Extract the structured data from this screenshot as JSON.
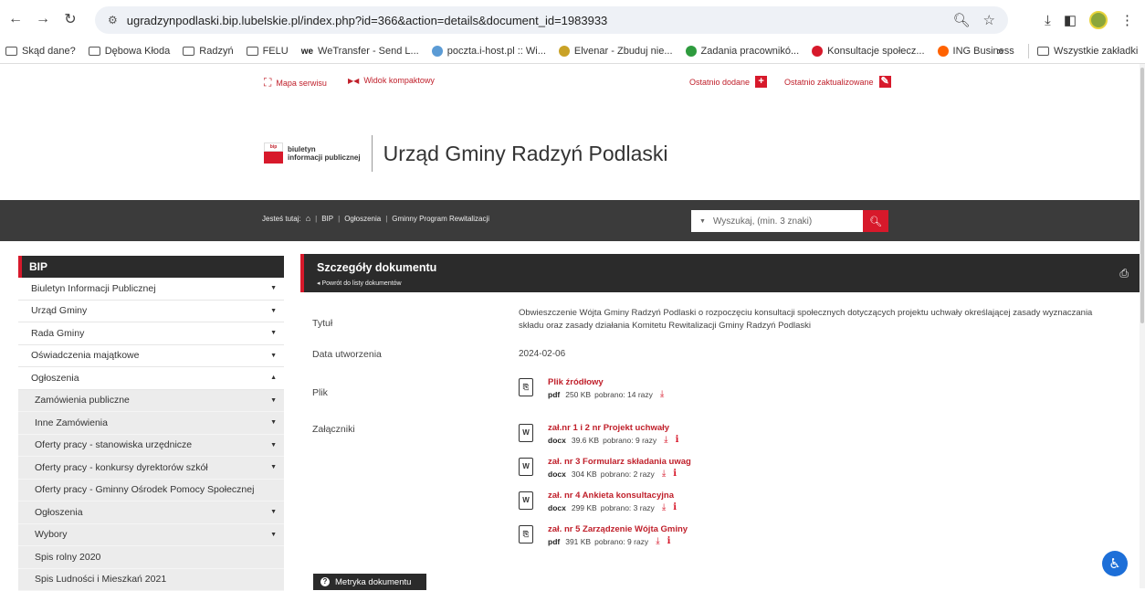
{
  "browser": {
    "url": "ugradzynpodlaski.bip.lubelskie.pl/index.php?id=366&action=details&document_id=1983933",
    "bookmarks": [
      {
        "label": "Skąd dane?",
        "icon": "folder-icon"
      },
      {
        "label": "Dębowa Kłoda",
        "icon": "folder-icon"
      },
      {
        "label": "Radzyń",
        "icon": "folder-icon"
      },
      {
        "label": "FELU",
        "icon": "folder-icon"
      },
      {
        "label": "WeTransfer - Send L...",
        "icon": "wetransfer-icon"
      },
      {
        "label": "poczta.i-host.pl :: Wi...",
        "icon": "mail-icon"
      },
      {
        "label": "Elvenar - Zbuduj nie...",
        "icon": "elvenar-icon"
      },
      {
        "label": "Zadania pracownikó...",
        "icon": "plus-icon"
      },
      {
        "label": "Konsultacje społecz...",
        "icon": "flag-icon"
      },
      {
        "label": "ING Business",
        "icon": "ing-icon"
      }
    ],
    "bookmarks_more": "»",
    "all_bookmarks": "Wszystkie zakładki"
  },
  "top_links": {
    "sitemap": "Mapa serwisu",
    "compact": "Widok kompaktowy",
    "recent_added": "Ostatnio dodane",
    "recent_updated": "Ostatnio zaktualizowane"
  },
  "header": {
    "logo_line1": "biuletyn",
    "logo_line2": "informacji publicznej",
    "logo_badge": "bip",
    "site_title": "Urząd Gminy Radzyń Podlaski"
  },
  "breadcrumb": {
    "prefix": "Jesteś tutaj:",
    "items": [
      "BIP",
      "Ogłoszenia",
      "Gminny Program Rewitalizacji"
    ]
  },
  "search": {
    "placeholder": "Wyszukaj, (min. 3 znaki)"
  },
  "sidebar": {
    "title": "BIP",
    "items": [
      {
        "label": "Biuletyn Informacji Publicznej",
        "arrow": "▼",
        "sub": false
      },
      {
        "label": "Urząd Gminy",
        "arrow": "▼",
        "sub": false
      },
      {
        "label": "Rada Gminy",
        "arrow": "▼",
        "sub": false
      },
      {
        "label": "Oświadczenia majątkowe",
        "arrow": "▼",
        "sub": false
      },
      {
        "label": "Ogłoszenia",
        "arrow": "▲",
        "sub": false
      },
      {
        "label": "Zamówienia publiczne",
        "arrow": "▼",
        "sub": true
      },
      {
        "label": "Inne Zamówienia",
        "arrow": "▼",
        "sub": true
      },
      {
        "label": "Oferty pracy - stanowiska urzędnicze",
        "arrow": "▼",
        "sub": true
      },
      {
        "label": "Oferty pracy - konkursy dyrektorów szkół",
        "arrow": "▼",
        "sub": true
      },
      {
        "label": "Oferty pracy - Gminny Ośrodek Pomocy Społecznej",
        "arrow": "",
        "sub": true
      },
      {
        "label": "Ogłoszenia",
        "arrow": "▼",
        "sub": true
      },
      {
        "label": "Wybory",
        "arrow": "▼",
        "sub": true
      },
      {
        "label": "Spis rolny 2020",
        "arrow": "",
        "sub": true
      },
      {
        "label": "Spis Ludności i Mieszkań 2021",
        "arrow": "",
        "sub": true
      }
    ]
  },
  "document": {
    "heading": "Szczegóły dokumentu",
    "back_link": "◂ Powrót do listy dokumentów",
    "labels": {
      "title": "Tytuł",
      "created": "Data utworzenia",
      "file": "Plik",
      "attachments": "Załączniki"
    },
    "title": "Obwieszczenie Wójta Gminy Radzyń Podlaski o rozpoczęciu konsultacji społecznych dotyczących projektu uchwały określającej zasady wyznaczania składu oraz zasady działania Komitetu Rewitalizacji Gminy Radzyń Podlaski",
    "created": "2024-02-06",
    "file": {
      "name": "Plik źródłowy",
      "type": "pdf",
      "size": "250 KB",
      "downloads": "pobrano: 14 razy"
    },
    "attachments": [
      {
        "name": "zał.nr 1 i 2 nr Projekt uchwały",
        "type": "docx",
        "size": "39.6 KB",
        "downloads": "pobrano: 9 razy"
      },
      {
        "name": "zał. nr 3 Formularz składania uwag",
        "type": "docx",
        "size": "304 KB",
        "downloads": "pobrano: 2 razy"
      },
      {
        "name": "zał. nr 4 Ankieta konsultacyjna",
        "type": "docx",
        "size": "299 KB",
        "downloads": "pobrano: 3 razy"
      },
      {
        "name": "zał. nr 5 Zarządzenie Wójta Gminy",
        "type": "pdf",
        "size": "391 KB",
        "downloads": "pobrano: 9 razy"
      }
    ],
    "metryka": "Metryka dokumentu"
  },
  "colors": {
    "accent": "#d7192b",
    "dark_bar": "#2b2b2b"
  }
}
